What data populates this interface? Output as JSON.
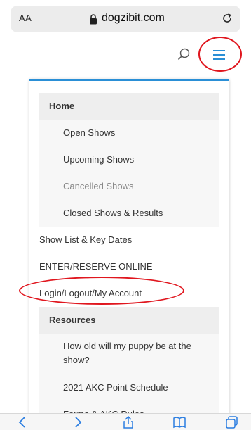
{
  "browser": {
    "text_size_label": "AA",
    "domain": "dogzibit.com",
    "icons": [
      "lock-icon",
      "reload-icon",
      "back-icon",
      "forward-icon",
      "share-icon",
      "bookmarks-icon",
      "tabs-icon"
    ]
  },
  "header": {
    "icons": [
      "search-icon",
      "hamburger-menu-icon"
    ],
    "accent_color": "#2a8fd6",
    "highlight_color": "#e0161e"
  },
  "menu": {
    "items": [
      {
        "label": "Home"
      },
      {
        "label": "Open Shows"
      },
      {
        "label": "Upcoming Shows"
      },
      {
        "label": "Cancelled Shows"
      },
      {
        "label": "Closed Shows & Results"
      },
      {
        "label": "Show List & Key Dates"
      },
      {
        "label": "ENTER/RESERVE ONLINE"
      },
      {
        "label": "Login/Logout/My Account"
      },
      {
        "label": "Resources"
      },
      {
        "label": "How old will my puppy be at the show?"
      },
      {
        "label": "2021 AKC Point Schedule"
      },
      {
        "label": "Forms & AKC Rules"
      }
    ]
  }
}
